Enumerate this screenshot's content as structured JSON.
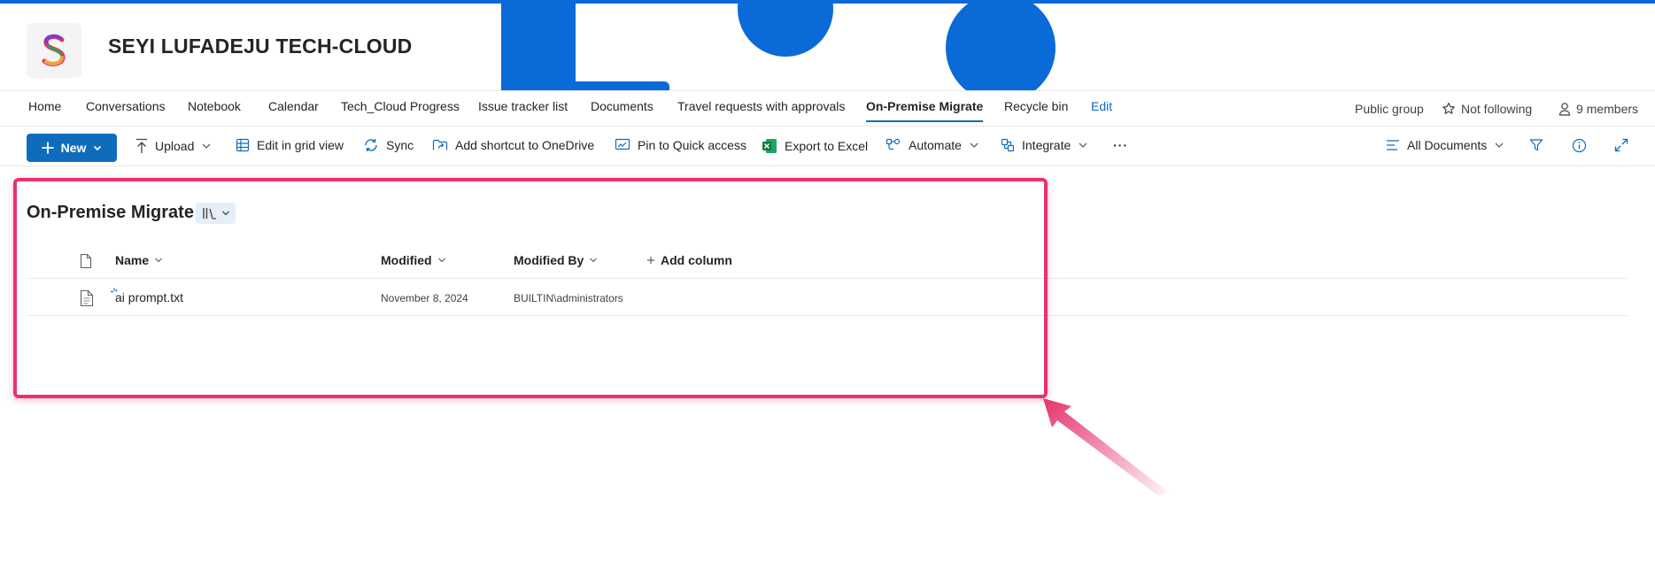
{
  "site": {
    "title": "SEYI LUFADEJU TECH-CLOUD",
    "logo_letter": "S",
    "accent_color": "#0f6cbd",
    "banner_color": "#0a6ad7"
  },
  "nav": {
    "items": [
      {
        "label": "Home"
      },
      {
        "label": "Conversations"
      },
      {
        "label": "Notebook"
      },
      {
        "label": "Calendar"
      },
      {
        "label": "Tech_Cloud Progress"
      },
      {
        "label": "Issue tracker list"
      },
      {
        "label": "Documents"
      },
      {
        "label": "Travel requests with approvals"
      },
      {
        "label": "On-Premise Migrate",
        "active": true
      },
      {
        "label": "Recycle bin"
      },
      {
        "label": "Edit"
      }
    ],
    "group_type": "Public group",
    "follow_label": "Not following",
    "members_label": "9 members"
  },
  "commandbar": {
    "new_label": "New",
    "upload_label": "Upload",
    "grid_label": "Edit in grid view",
    "sync_label": "Sync",
    "shortcut_label": "Add shortcut to OneDrive",
    "pin_label": "Pin to Quick access",
    "export_label": "Export to Excel",
    "automate_label": "Automate",
    "integrate_label": "Integrate",
    "more_label": "···",
    "view_label": "All Documents"
  },
  "library": {
    "title": "On-Premise Migrate",
    "columns": {
      "name": "Name",
      "modified": "Modified",
      "modified_by": "Modified By",
      "add_column": "Add column"
    },
    "rows": [
      {
        "name": "ai prompt.txt",
        "modified": "November 8, 2024",
        "modified_by": "BUILTIN\\administrators"
      }
    ]
  },
  "annotation": {
    "color": "#e5336b"
  }
}
